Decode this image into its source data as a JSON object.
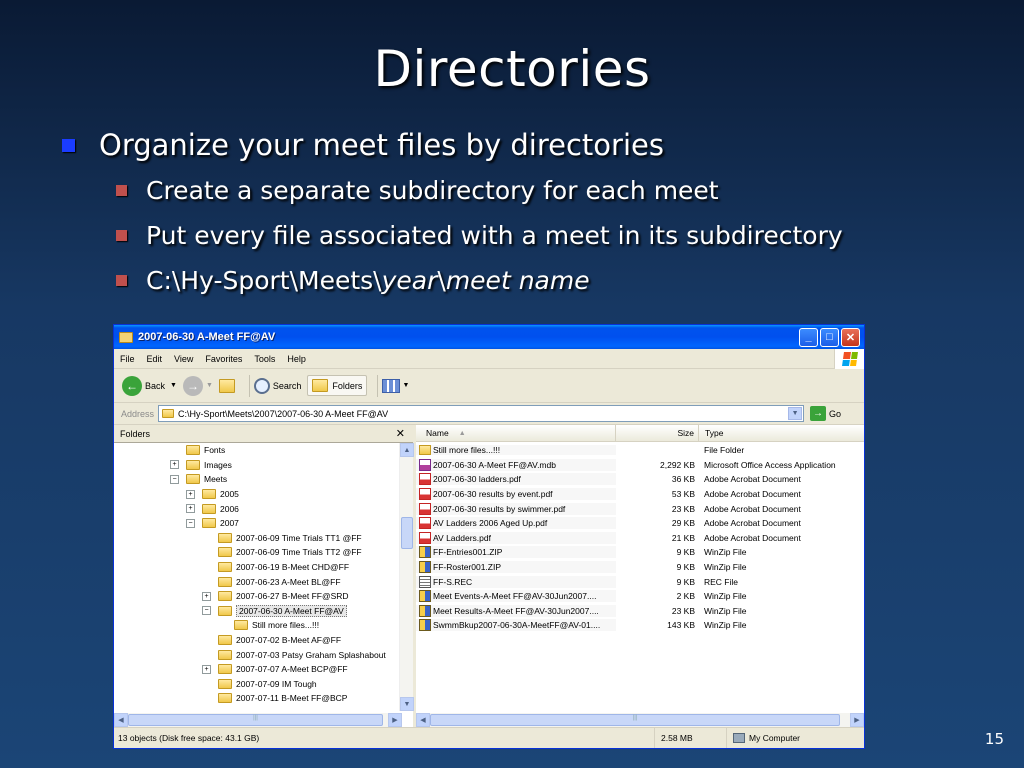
{
  "slide": {
    "title": "Directories",
    "bullet1": "Organize your meet files by directories",
    "bullet2": "Create a separate subdirectory for each meet",
    "bullet3": "Put every file associated with a meet in its subdirectory",
    "bullet4": {
      "prefix": "C:\\Hy-Sport\\Meets\\",
      "italic1": "year",
      "sep": "\\",
      "italic2": "meet name"
    },
    "page_number": "15"
  },
  "window": {
    "title": "2007-06-30 A-Meet FF@AV",
    "menu": [
      "File",
      "Edit",
      "View",
      "Favorites",
      "Tools",
      "Help"
    ],
    "toolbar": {
      "back": "Back",
      "search": "Search",
      "folders": "Folders"
    },
    "address": {
      "label": "Address",
      "path": "C:\\Hy-Sport\\Meets\\2007\\2007-06-30 A-Meet FF@AV",
      "go": "Go"
    },
    "folders_pane": {
      "title": "Folders",
      "close": "✕",
      "items": [
        {
          "label": "Fonts",
          "toggle": ""
        },
        {
          "label": "Images",
          "toggle": "+"
        },
        {
          "label": "Meets",
          "toggle": "−"
        },
        {
          "label": "2005",
          "toggle": "+"
        },
        {
          "label": "2006",
          "toggle": "+"
        },
        {
          "label": "2007",
          "toggle": "−"
        },
        {
          "label": "2007-06-09 Time Trials TT1 @FF",
          "toggle": ""
        },
        {
          "label": "2007-06-09 Time Trials TT2 @FF",
          "toggle": ""
        },
        {
          "label": "2007-06-19 B-Meet CHD@FF",
          "toggle": ""
        },
        {
          "label": "2007-06-23 A-Meet BL@FF",
          "toggle": ""
        },
        {
          "label": "2007-06-27 B-Meet FF@SRD",
          "toggle": "+"
        },
        {
          "label": "2007-06-30 A-Meet FF@AV",
          "toggle": "−"
        },
        {
          "label": "Still more files...!!!",
          "toggle": ""
        },
        {
          "label": "2007-07-02 B-Meet AF@FF",
          "toggle": ""
        },
        {
          "label": "2007-07-03 Patsy Graham Splashabout",
          "toggle": ""
        },
        {
          "label": "2007-07-07 A-Meet BCP@FF",
          "toggle": "+"
        },
        {
          "label": "2007-07-09 IM Tough",
          "toggle": ""
        },
        {
          "label": "2007-07-11 B-Meet FF@BCP",
          "toggle": ""
        }
      ]
    },
    "columns": {
      "name": "Name",
      "size": "Size",
      "type": "Type"
    },
    "files": [
      {
        "name": "Still more files...!!!",
        "size": "",
        "type": "File Folder",
        "icon": "folder"
      },
      {
        "name": "2007-06-30 A-Meet FF@AV.mdb",
        "size": "2,292 KB",
        "type": "Microsoft Office Access Application",
        "icon": "mdb"
      },
      {
        "name": "2007-06-30 ladders.pdf",
        "size": "36 KB",
        "type": "Adobe Acrobat Document",
        "icon": "pdf"
      },
      {
        "name": "2007-06-30 results by event.pdf",
        "size": "53 KB",
        "type": "Adobe Acrobat Document",
        "icon": "pdf"
      },
      {
        "name": "2007-06-30 results by swimmer.pdf",
        "size": "23 KB",
        "type": "Adobe Acrobat Document",
        "icon": "pdf"
      },
      {
        "name": "AV Ladders 2006 Aged Up.pdf",
        "size": "29 KB",
        "type": "Adobe Acrobat Document",
        "icon": "pdf"
      },
      {
        "name": "AV Ladders.pdf",
        "size": "21 KB",
        "type": "Adobe Acrobat Document",
        "icon": "pdf"
      },
      {
        "name": "FF-Entries001.ZIP",
        "size": "9 KB",
        "type": "WinZip File",
        "icon": "zip"
      },
      {
        "name": "FF-Roster001.ZIP",
        "size": "9 KB",
        "type": "WinZip File",
        "icon": "zip"
      },
      {
        "name": "FF-S.REC",
        "size": "9 KB",
        "type": "REC File",
        "icon": "rec"
      },
      {
        "name": "Meet Events-A-Meet FF@AV-30Jun2007....",
        "size": "2 KB",
        "type": "WinZip File",
        "icon": "zip"
      },
      {
        "name": "Meet Results-A-Meet FF@AV-30Jun2007....",
        "size": "23 KB",
        "type": "WinZip File",
        "icon": "zip"
      },
      {
        "name": "SwmmBkup2007-06-30A-MeetFF@AV-01....",
        "size": "143 KB",
        "type": "WinZip File",
        "icon": "zip"
      }
    ],
    "status": {
      "objects": "13 objects (Disk free space: 43.1 GB)",
      "size": "2.58 MB",
      "location": "My Computer"
    }
  }
}
